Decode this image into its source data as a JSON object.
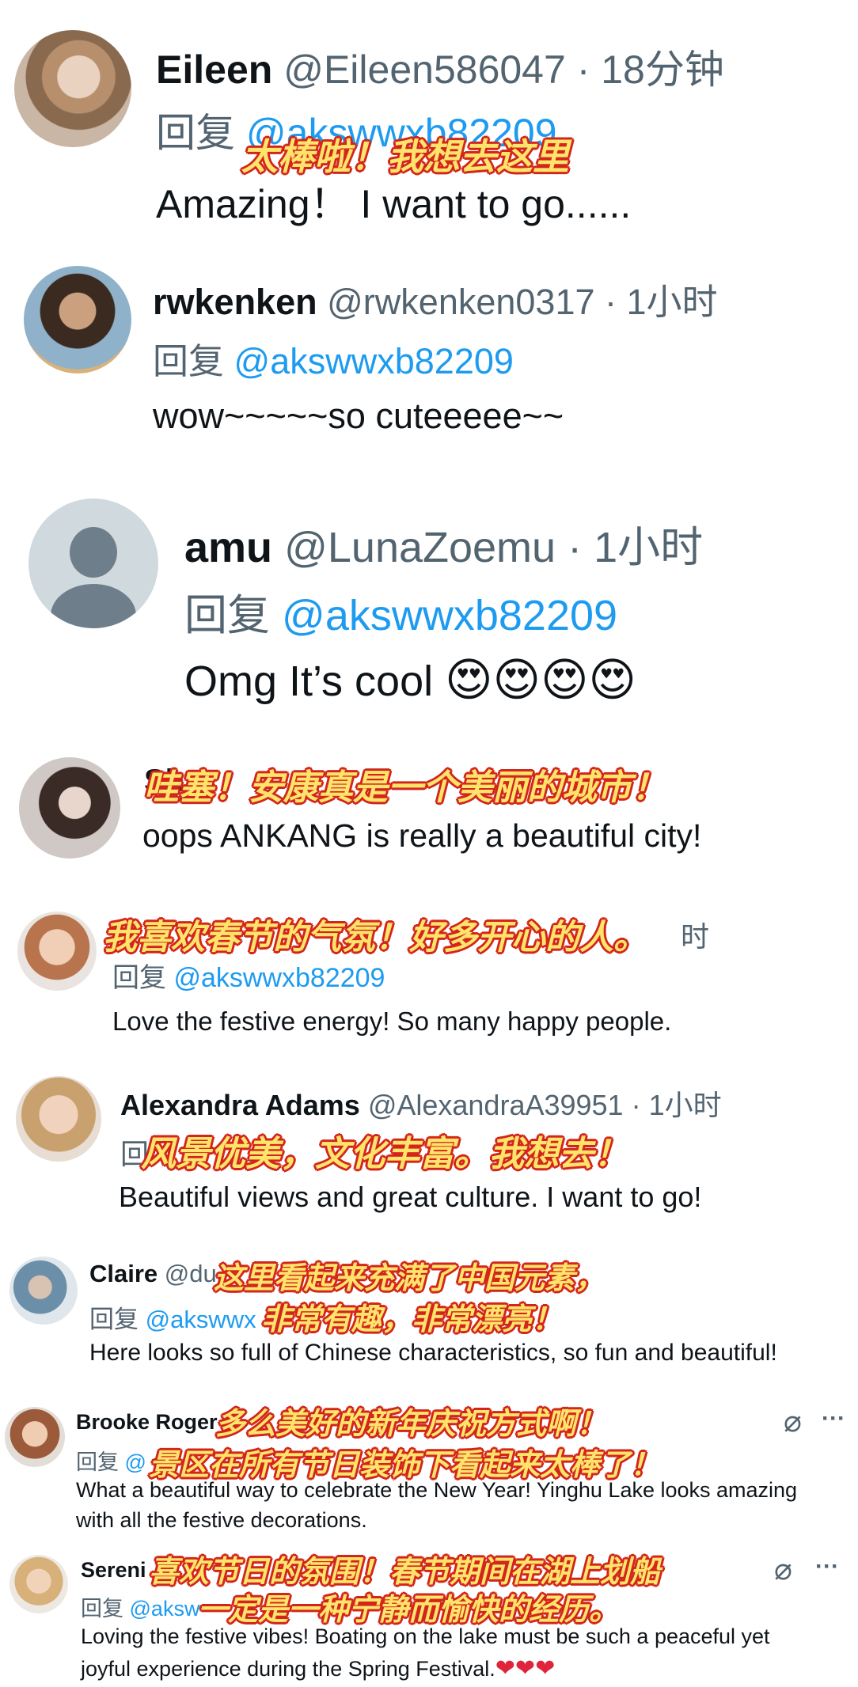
{
  "comments": [
    {
      "name": "Eileen",
      "handle": "@Eileen586047",
      "time": "· 18分钟",
      "reply_prefix": "回复",
      "mention": "@akswwxb82209",
      "text": "Amazing！ I  want to go......",
      "caption": "太棒啦！我想去这里"
    },
    {
      "name": "rwkenken",
      "handle": "@rwkenken0317",
      "time": "· 1小时",
      "reply_prefix": "回复",
      "mention": "@akswwxb82209",
      "text": "wow~~~~~so cuteeeee~~"
    },
    {
      "name": "amu",
      "handle": "@LunaZoemu",
      "time": "· 1小时",
      "reply_prefix": "回复",
      "mention": "@akswwxb82209",
      "text": "Omg It’s cool",
      "emoji": "😍😍😍😍"
    },
    {
      "name": "Sha",
      "text": "oops ANKANG is really a beautiful city!",
      "caption": "哇塞！安康真是一个美丽的城市！"
    },
    {
      "time": "时",
      "reply_prefix": "回复",
      "mention": "@akswwxb82209",
      "text": "Love the festive energy! So many happy people.",
      "caption": "我喜欢春节的气氛！好多开心的人。"
    },
    {
      "name": "Alexandra Adams",
      "handle": "@AlexandraA39951",
      "time": "· 1小时",
      "reply_prefix": "回",
      "text": "Beautiful views and great culture. I want to go!",
      "caption": "风景优美，文化丰富。我想去！"
    },
    {
      "name": "Claire",
      "handle": "@du",
      "reply_prefix": "回复",
      "mention": "@akswwx",
      "text": "Here looks so full of Chinese characteristics, so fun and beautiful!",
      "caption_1": "这里看起来充满了中国元素，",
      "caption_2": "非常有趣，非常漂亮！"
    },
    {
      "name": "Brooke Roger",
      "reply_prefix": "回复",
      "mention": "@",
      "text_1": "What a beautiful way to celebrate the New Year! Yinghu Lake looks amazing",
      "text_2": "with all the festive decorations.",
      "caption_1": "多么美好的新年庆祝方式啊！",
      "caption_2": "景区在所有节日装饰下看起来太棒了！",
      "more": "···",
      "grok": "⌀"
    },
    {
      "name": "Sereni",
      "reply_prefix": "回复",
      "mention": "@aksw",
      "text_1": "Loving the festive vibes! Boating on the lake must be such a peaceful yet",
      "text_2": "joyful experience during the Spring Festival.",
      "hearts": "❤❤❤",
      "caption_1": "喜欢节日的氛围！春节期间在湖上划船",
      "caption_2": "一定是一种宁静而愉快的经历。",
      "more": "···",
      "grok": "⌀"
    }
  ],
  "colors": {
    "link": "#1d9bf0",
    "muted": "#536471",
    "caption_fill": "#ffe46b",
    "caption_outline": "#d2261c"
  }
}
